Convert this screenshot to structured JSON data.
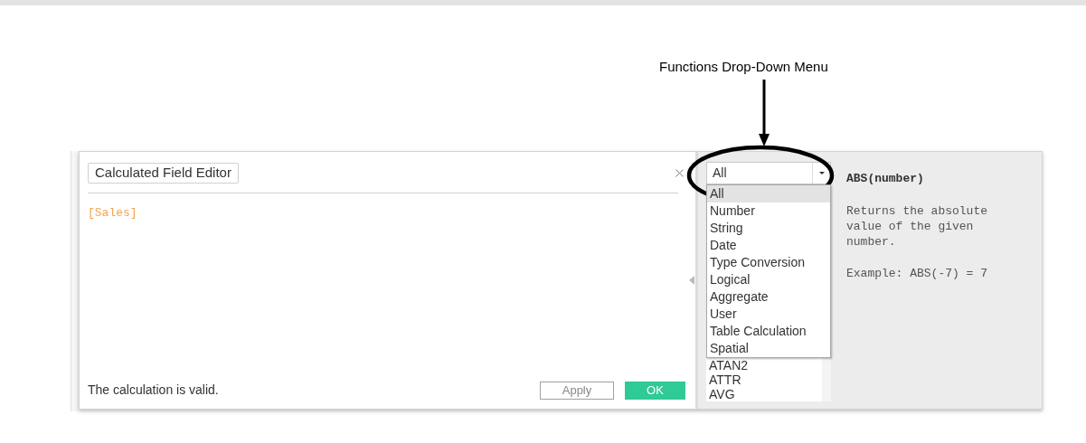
{
  "annotation": {
    "label": "Functions Drop-Down Menu"
  },
  "editor": {
    "title": "Calculated Field Editor",
    "formula": "[Sales]",
    "status": "The calculation is valid.",
    "buttons": [
      {
        "label": "Apply",
        "kind": "secondary"
      },
      {
        "label": "OK",
        "kind": "primary"
      }
    ]
  },
  "functions": {
    "category": "All",
    "menu": [
      {
        "label": "All",
        "selected": true
      },
      {
        "label": "Number",
        "selected": false
      },
      {
        "label": "String",
        "selected": false
      },
      {
        "label": "Date",
        "selected": false
      },
      {
        "label": "Type Conversion",
        "selected": false
      },
      {
        "label": "Logical",
        "selected": false
      },
      {
        "label": "Aggregate",
        "selected": false
      },
      {
        "label": "User",
        "selected": false
      },
      {
        "label": "Table Calculation",
        "selected": false
      },
      {
        "label": "Spatial",
        "selected": false
      }
    ],
    "list": [
      "ATAN2",
      "ATTR",
      "AVG"
    ]
  },
  "help": {
    "signature": "ABS(number)",
    "description": "Returns the absolute value of the given number.",
    "example": "Example: ABS(-7) = 7"
  }
}
